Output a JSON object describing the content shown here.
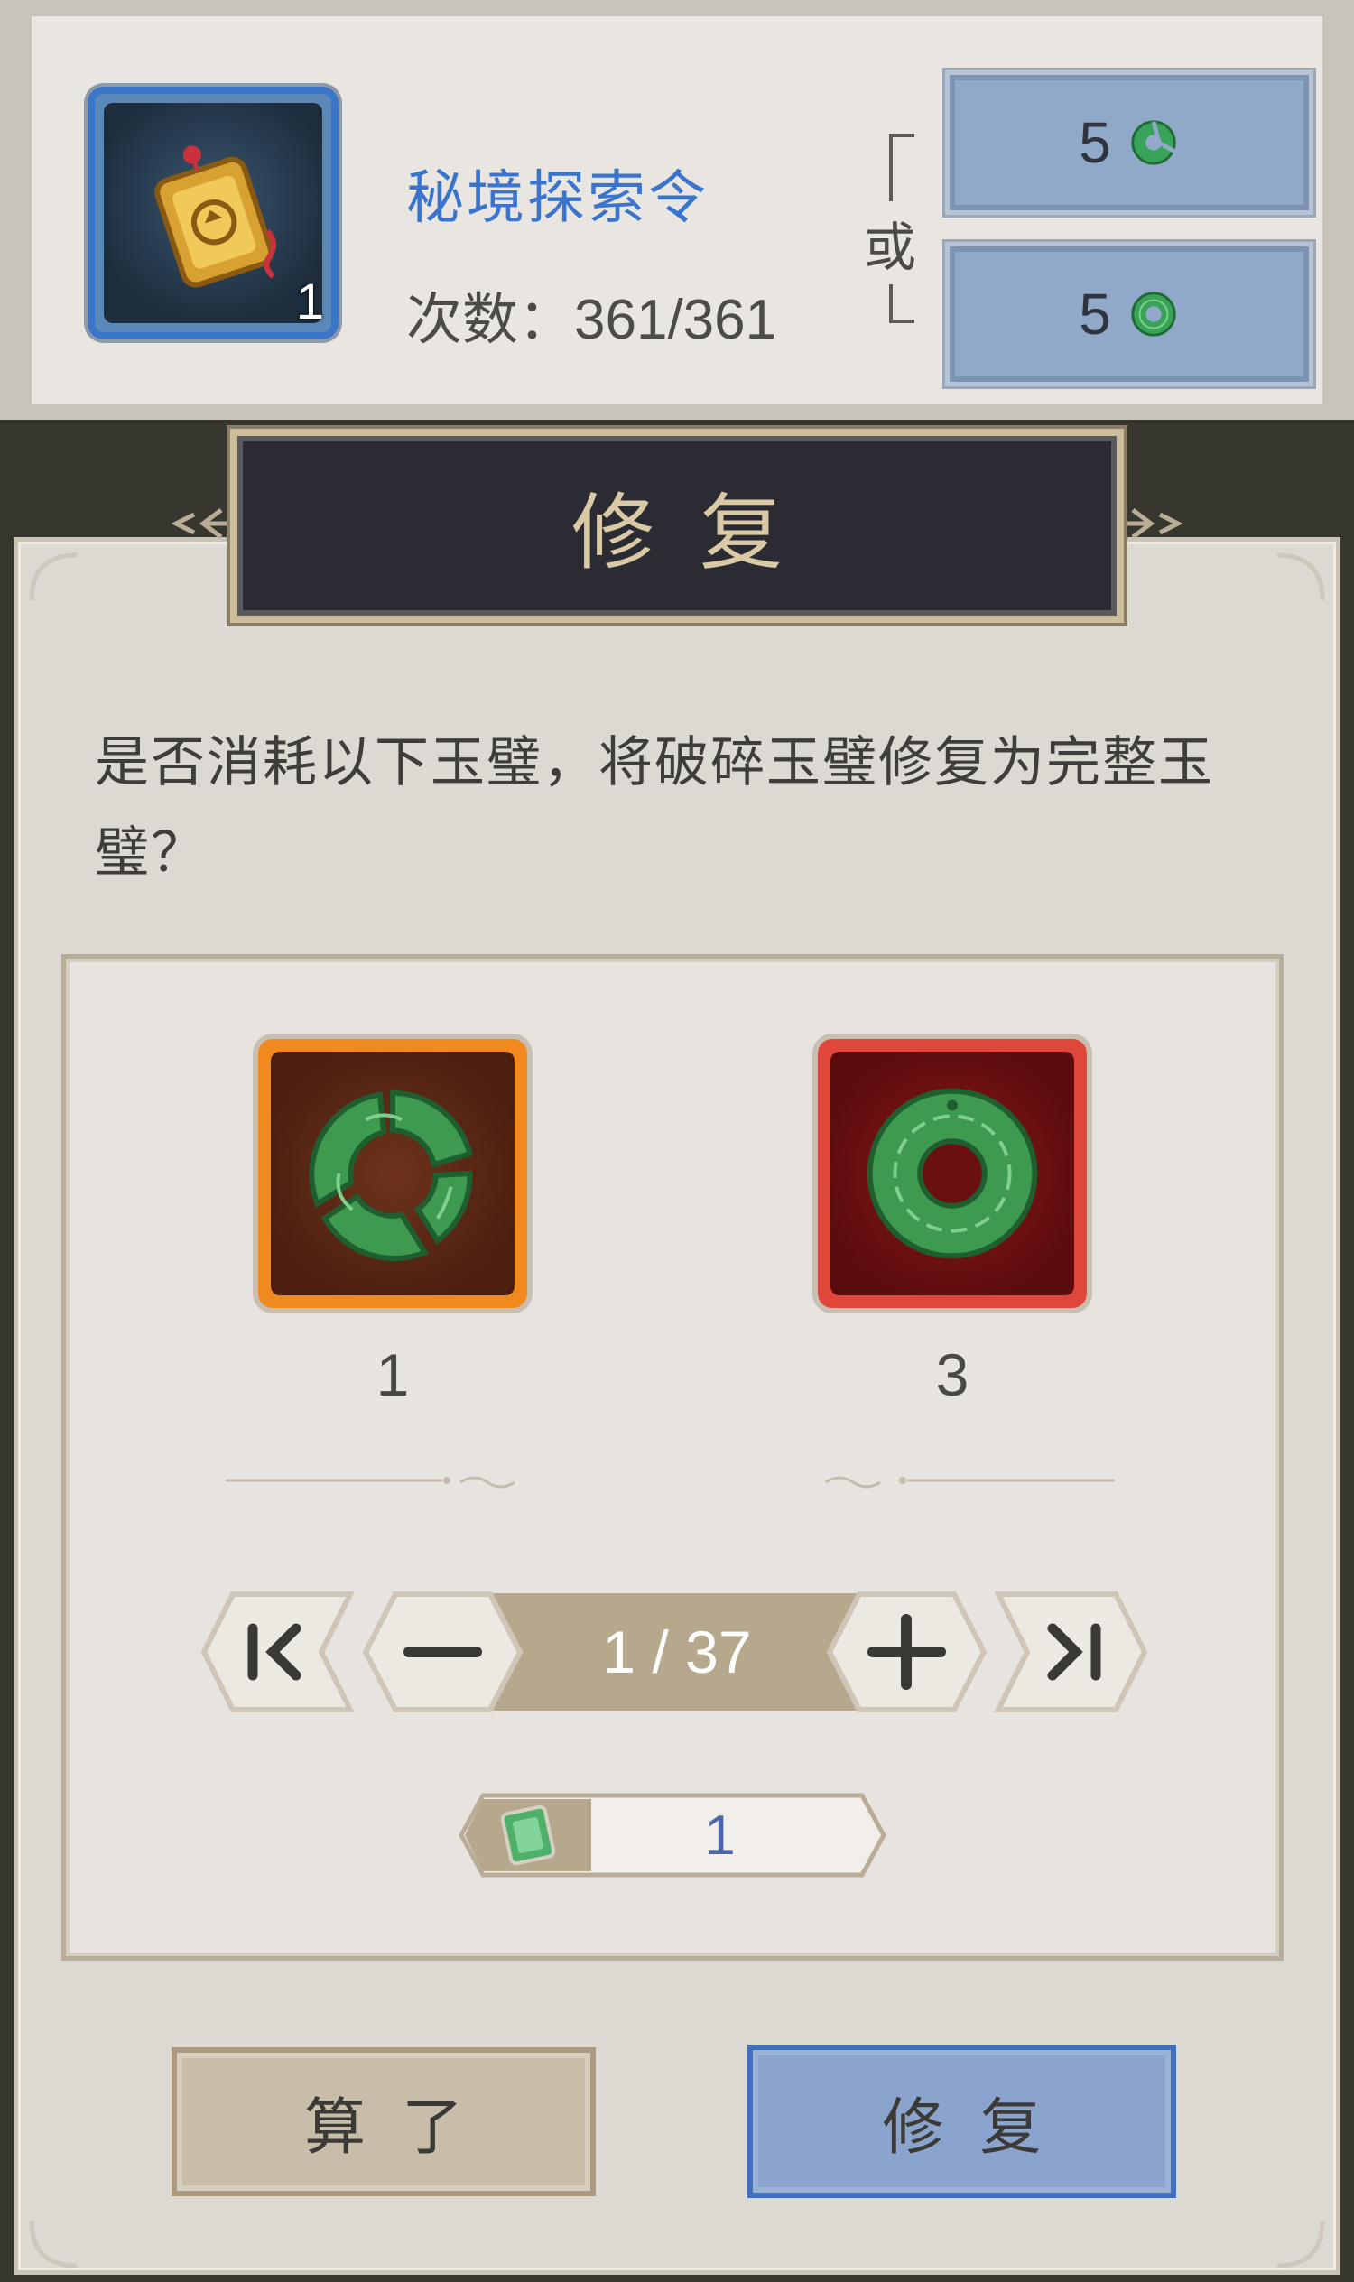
{
  "top_card": {
    "item_name": "秘境探索令",
    "item_count": "1",
    "uses_label": "次数：",
    "uses_value": "361/361",
    "or_label": "或",
    "cost_options": [
      {
        "amount": "5",
        "icon": "broken-jade-icon"
      },
      {
        "amount": "5",
        "icon": "jade-disc-icon"
      }
    ]
  },
  "dialog": {
    "title": "修复",
    "question": "是否消耗以下玉璧，将破碎玉璧修复为完整玉璧？",
    "source_item": {
      "icon": "broken-jade-disc-icon",
      "quantity": "1"
    },
    "result_item": {
      "icon": "jade-disc-icon",
      "quantity": "3"
    },
    "stepper": {
      "current": "1",
      "max": "37",
      "display": "1 / 37"
    },
    "cost": {
      "icon": "jade-gem-icon",
      "amount": "1"
    },
    "cancel_label": "算了",
    "confirm_label": "修复"
  },
  "colors": {
    "accent_blue": "#3b76c8",
    "panel_bg": "#dcd8d2",
    "title_plate": "#2b2c33",
    "rarity_orange": "#f08a1e",
    "rarity_red": "#e0473b"
  }
}
